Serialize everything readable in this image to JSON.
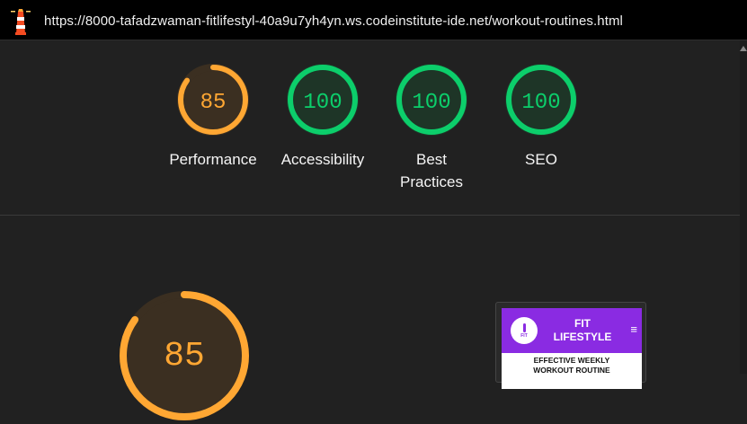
{
  "browser": {
    "url": "https://8000-tafadzwaman-fitlifestyl-40a9u7yh4yn.ws.codeinstitute-ide.net/workout-routines.html"
  },
  "colors": {
    "average": "#ffa733",
    "pass": "#0cce6b",
    "average_bg": "#3b2f21",
    "pass_bg": "#1e3527"
  },
  "scores": [
    {
      "value": "85",
      "label": "Performance",
      "status": "average"
    },
    {
      "value": "100",
      "label": "Accessibility",
      "status": "pass"
    },
    {
      "value": "100",
      "label": "Best Practices",
      "status": "pass"
    },
    {
      "value": "100",
      "label": "SEO",
      "status": "pass"
    }
  ],
  "detail": {
    "score": "85"
  },
  "thumbnail": {
    "logo_text": "FIT",
    "brand_line1": "FIT",
    "brand_line2": "LIFESTYLE",
    "menu_icon": "≡",
    "heading_line1": "EFFECTIVE WEEKLY",
    "heading_line2": "WORKOUT ROUTINE"
  }
}
